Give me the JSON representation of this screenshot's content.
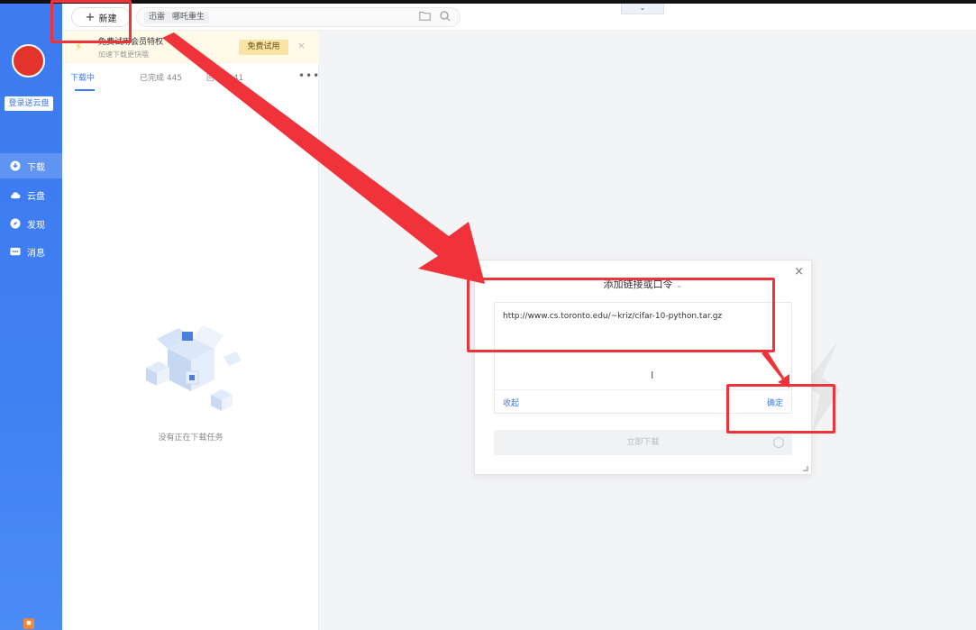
{
  "toolbar": {
    "new_label": "新建",
    "search_tags": [
      "迅雷",
      "哪吒重生"
    ],
    "collapse_glyph": "⌄"
  },
  "sidebar": {
    "login_label": "登录送云盘",
    "items": [
      {
        "label": "下载",
        "icon": "download-icon",
        "active": true
      },
      {
        "label": "云盘",
        "icon": "cloud-icon",
        "active": false
      },
      {
        "label": "发现",
        "icon": "compass-icon",
        "active": false
      },
      {
        "label": "消息",
        "icon": "message-icon",
        "active": false
      }
    ]
  },
  "promo": {
    "title": "免费试用会员特权",
    "subtitle": "加速下载更快哦",
    "button": "免费试用",
    "close": "×"
  },
  "tabs": [
    {
      "label": "下载中",
      "active": true
    },
    {
      "label": "已完成 445",
      "active": false
    },
    {
      "label": "回收站 41",
      "active": false
    }
  ],
  "tabs_more": "•••",
  "empty_text": "没有正在下载任务",
  "dialog": {
    "title": "添加链接或口令",
    "title_suffix": "⌄",
    "close": "×",
    "link_value": "http://www.cs.toronto.edu/~kriz/cifar-10-python.tar.gz",
    "collapse": "收起",
    "confirm": "确定",
    "download_now": "立即下载",
    "text_cursor": "I"
  },
  "colors": {
    "accent": "#3e7af0",
    "annotation": "#f0333a",
    "avatar": "#e2332d"
  }
}
